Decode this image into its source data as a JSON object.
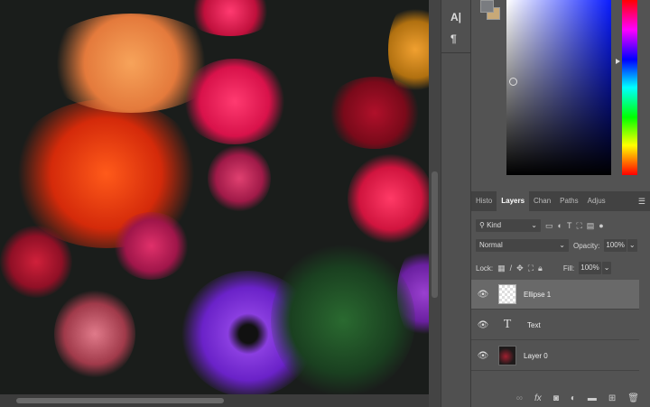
{
  "tools": {
    "character_icon": "A|",
    "paragraph_icon": "¶"
  },
  "color": {
    "foreground": "#7a7c80",
    "background": "#c8a978",
    "hue": "#0a1cff"
  },
  "tabs": [
    "Histo",
    "Layers",
    "Chan",
    "Paths",
    "Adjus"
  ],
  "active_tab": "Layers",
  "filter": {
    "kind": "Kind"
  },
  "blend": {
    "mode": "Normal",
    "opacity_label": "Opacity:",
    "opacity": "100%"
  },
  "lock": {
    "label": "Lock:",
    "fill_label": "Fill:",
    "fill": "100%"
  },
  "layers": [
    {
      "name": "Ellipse 1",
      "selected": true
    },
    {
      "name": "Text",
      "selected": false
    },
    {
      "name": "Layer 0",
      "selected": false
    }
  ],
  "bottom_icons": [
    "link-icon",
    "fx-icon",
    "mask-icon",
    "adjustment-icon",
    "folder-icon",
    "new-layer-icon",
    "trash-icon"
  ],
  "fx_label": "fx"
}
